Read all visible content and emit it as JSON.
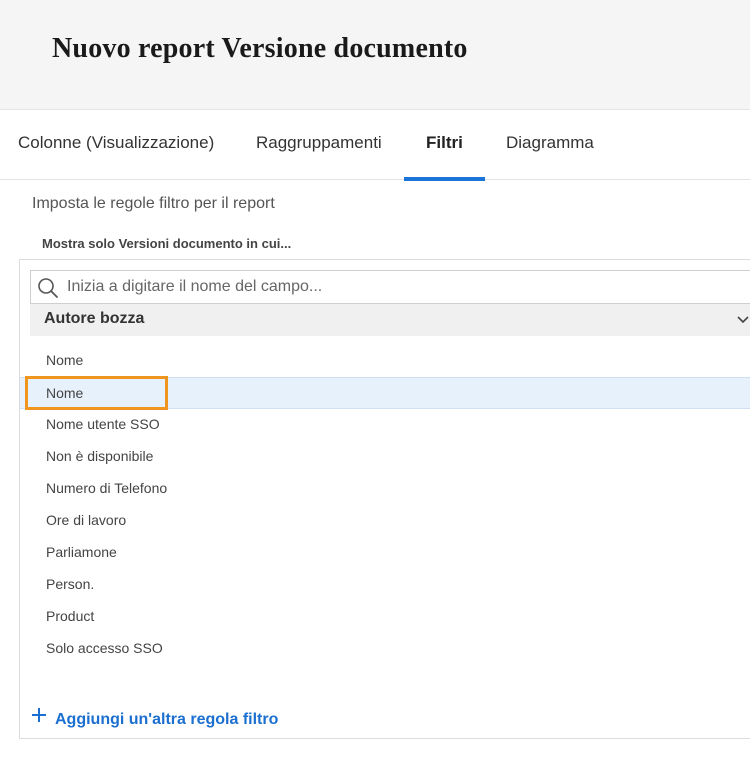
{
  "header": {
    "title": "Nuovo report Versione documento"
  },
  "tabs": [
    {
      "label": "Colonne (Visualizzazione)",
      "active": false
    },
    {
      "label": "Raggruppamenti",
      "active": false
    },
    {
      "label": "Filtri",
      "active": true
    },
    {
      "label": "Diagramma",
      "active": false
    }
  ],
  "filters": {
    "intro": "Imposta le regole filtro per il report",
    "subhead": "Mostra solo Versioni documento in cui...",
    "search": {
      "placeholder": "Inizia a digitare il nome del campo...",
      "value": ""
    },
    "group": {
      "label": "Autore bozza",
      "icon": "chevron-down-icon"
    },
    "options": [
      {
        "label": "Nome"
      },
      {
        "label": "Nome",
        "selected": true
      },
      {
        "label": "Nome utente SSO"
      },
      {
        "label": "Non è disponibile"
      },
      {
        "label": "Numero di Telefono"
      },
      {
        "label": "Ore di lavoro"
      },
      {
        "label": "Parliamone"
      },
      {
        "label": "Person."
      },
      {
        "label": "Product"
      },
      {
        "label": "Solo accesso SSO"
      }
    ],
    "add_rule": {
      "label": "Aggiungi un'altra regola filtro",
      "icon": "plus-icon"
    }
  },
  "colors": {
    "accent": "#1b74d8",
    "link": "#1b6fd0",
    "selected_bg": "#e7f1fb",
    "callout": "#f0961e",
    "header_bg": "#f5f5f5"
  }
}
